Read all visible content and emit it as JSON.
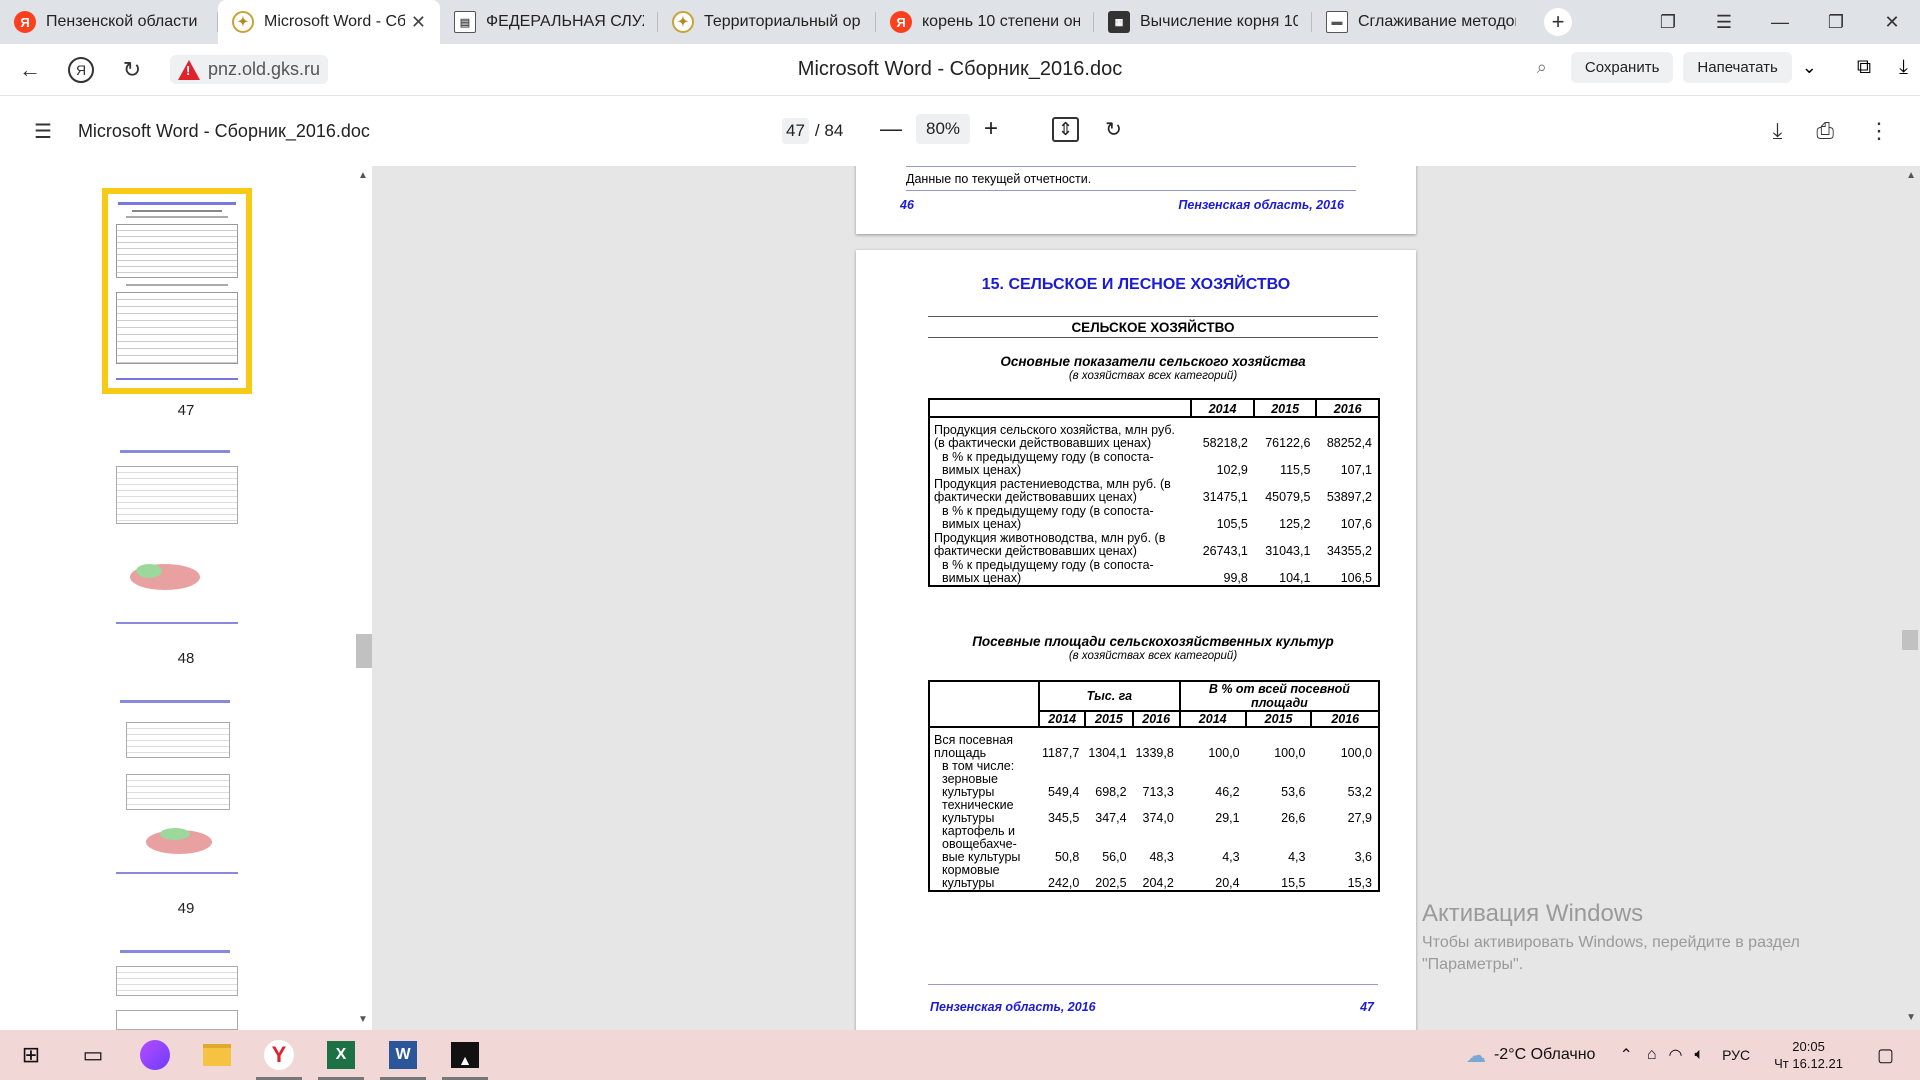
{
  "tabs": [
    {
      "label": "Пензенской области",
      "favicon": "yandex-favicon",
      "active": false
    },
    {
      "label": "Microsoft Word - Сб",
      "favicon": "gks-favicon",
      "active": true
    },
    {
      "label": "ФЕДЕРАЛЬНАЯ СЛУЖ",
      "favicon": "document-favicon",
      "active": false
    },
    {
      "label": "Территориальный ор",
      "favicon": "gks-favicon",
      "active": false
    },
    {
      "label": "корень 10 степени он",
      "favicon": "yandex-favicon",
      "active": false
    },
    {
      "label": "Вычисление корня 10",
      "favicon": "calculator-favicon",
      "active": false
    },
    {
      "label": "Сглаживание методом",
      "favicon": "document-favicon",
      "active": false
    }
  ],
  "address": {
    "host": "pnz.old.gks.ru",
    "page_title": "Microsoft Word - Сборник_2016.doc",
    "save_label": "Сохранить",
    "print_label": "Напечатать"
  },
  "pdf_toolbar": {
    "title": "Microsoft Word - Сборник_2016.doc",
    "current_page": "47",
    "total_pages": "/ 84",
    "zoom": "80%"
  },
  "thumbnails": [
    {
      "page": "47",
      "selected": true
    },
    {
      "page": "48",
      "selected": false
    },
    {
      "page": "49",
      "selected": false
    }
  ],
  "prev_page": {
    "last_line": "Данные по текущей отчетности.",
    "footer_left": "46",
    "footer_right": "Пензенская область, 2016"
  },
  "page47": {
    "chapter": "15. СЕЛЬСКОЕ И ЛЕСНОЕ ХОЗЯЙСТВО",
    "section": "СЕЛЬСКОЕ ХОЗЯЙСТВО",
    "table1_title": "Основные показатели сельского хозяйства",
    "table1_subtitle": "(в хозяйствах всех категорий)",
    "table1_years": [
      "2014",
      "2015",
      "2016"
    ],
    "table1_rows": [
      {
        "label": "Продукция сельского хозяйства, млн руб. (в фактически действовавших ценах)",
        "v": [
          "58218,2",
          "76122,6",
          "88252,4"
        ],
        "indent": false
      },
      {
        "label": "в % к предыдущему году (в сопоста-вимых ценах)",
        "v": [
          "102,9",
          "115,5",
          "107,1"
        ],
        "indent": true
      },
      {
        "label": "Продукция растениеводства, млн руб. (в фактически действовавших ценах)",
        "v": [
          "31475,1",
          "45079,5",
          "53897,2"
        ],
        "indent": false
      },
      {
        "label": "в % к предыдущему году (в сопоста-вимых ценах)",
        "v": [
          "105,5",
          "125,2",
          "107,6"
        ],
        "indent": true
      },
      {
        "label": "Продукция животноводства, млн руб. (в фактически действовавших ценах)",
        "v": [
          "26743,1",
          "31043,1",
          "34355,2"
        ],
        "indent": false
      },
      {
        "label": "в % к предыдущему году (в сопоста-вимых ценах)",
        "v": [
          "99,8",
          "104,1",
          "106,5"
        ],
        "indent": true
      }
    ],
    "table2_title": "Посевные площади сельскохозяйственных культур",
    "table2_subtitle": "(в хозяйствах всех категорий)",
    "table2_head_a": "Тыс. га",
    "table2_head_b": "В % от всей посевной площади",
    "table2_years": [
      "2014",
      "2015",
      "2016",
      "2014",
      "2015",
      "2016"
    ],
    "table2_rows": [
      {
        "label": "Вся посевная площадь",
        "v": [
          "1187,7",
          "1304,1",
          "1339,8",
          "100,0",
          "100,0",
          "100,0"
        ],
        "indent": false
      },
      {
        "label": "в том числе:",
        "v": [
          "",
          "",
          "",
          "",
          "",
          ""
        ],
        "indent": true
      },
      {
        "label": "зерновые культуры",
        "v": [
          "549,4",
          "698,2",
          "713,3",
          "46,2",
          "53,6",
          "53,2"
        ],
        "indent": true
      },
      {
        "label": "технические культуры",
        "v": [
          "345,5",
          "347,4",
          "374,0",
          "29,1",
          "26,6",
          "27,9"
        ],
        "indent": true
      },
      {
        "label": "картофель и овощебахче-вые культуры",
        "v": [
          "50,8",
          "56,0",
          "48,3",
          "4,3",
          "4,3",
          "3,6"
        ],
        "indent": true
      },
      {
        "label": "кормовые культуры",
        "v": [
          "242,0",
          "202,5",
          "204,2",
          "20,4",
          "15,5",
          "15,3"
        ],
        "indent": true
      }
    ],
    "footer_left": "Пензенская область, 2016",
    "footer_right": "47"
  },
  "watermark": {
    "title": "Активация Windows",
    "line1": "Чтобы активировать Windows, перейдите в раздел",
    "line2": "\"Параметры\"."
  },
  "taskbar": {
    "weather": "-2°C  Облачно",
    "lang": "РУС",
    "time": "20:05",
    "date": "Чт 16.12.21"
  }
}
